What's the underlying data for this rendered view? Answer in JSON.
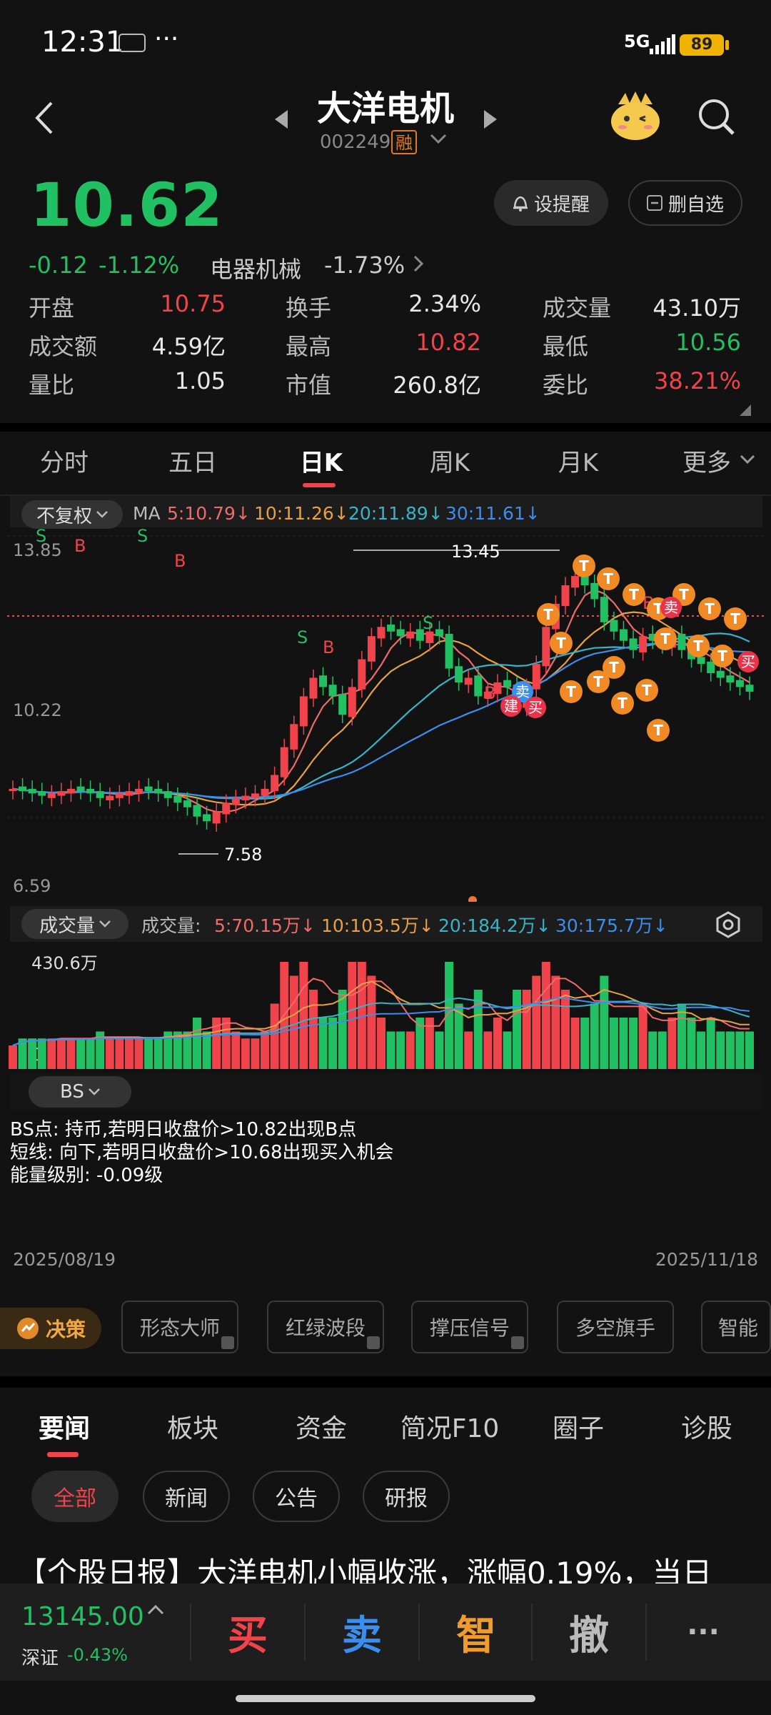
{
  "status": {
    "time": "12:31",
    "dots": "···",
    "network": "5G",
    "battery": "89"
  },
  "header": {
    "name": "大洋电机",
    "code": "002249",
    "margin_badge": "融"
  },
  "quote": {
    "price": "10.62",
    "change": "-0.12",
    "change_pct": "-1.12%",
    "sector": "电器机械",
    "sector_pct": "-1.73%",
    "alert_label": "设提醒",
    "watch_label": "删自选"
  },
  "stats": [
    {
      "label": "开盘",
      "value": "10.75",
      "color": "#f0434c"
    },
    {
      "label": "换手",
      "value": "2.34%",
      "color": "#e8e8e8"
    },
    {
      "label": "成交量",
      "value": "43.10万",
      "color": "#e8e8e8"
    },
    {
      "label": "成交额",
      "value": "4.59亿",
      "color": "#e8e8e8"
    },
    {
      "label": "最高",
      "value": "10.82",
      "color": "#f0434c"
    },
    {
      "label": "最低",
      "value": "10.56",
      "color": "#21c163"
    },
    {
      "label": "量比",
      "value": "1.05",
      "color": "#e8e8e8"
    },
    {
      "label": "市值",
      "value": "260.8亿",
      "color": "#e8e8e8"
    },
    {
      "label": "委比",
      "value": "38.21%",
      "color": "#f0434c"
    }
  ],
  "period_tabs": [
    "分时",
    "五日",
    "日K",
    "周K",
    "月K",
    "更多"
  ],
  "ma": {
    "adjust": "不复权",
    "label": "MA",
    "items": [
      {
        "text": "5:10.79↓",
        "color": "#f06a6a"
      },
      {
        "text": "10:11.26↓",
        "color": "#e8a040"
      },
      {
        "text": "20:11.89↓",
        "color": "#36b4c8"
      },
      {
        "text": "30:11.61↓",
        "color": "#3a8ef0"
      }
    ]
  },
  "kline": {
    "y_top": "13.85",
    "y_mid": "10.22",
    "y_bottom": "6.59",
    "high_label": "13.45",
    "low_label": "7.58"
  },
  "volume": {
    "button": "成交量",
    "label": "成交量:",
    "items": [
      {
        "text": "5:70.15万↓",
        "color": "#f06a6a"
      },
      {
        "text": "10:103.5万↓",
        "color": "#e8a040"
      },
      {
        "text": "20:184.2万↓",
        "color": "#36b4c8"
      },
      {
        "text": "30:175.7万↓",
        "color": "#3a8ef0"
      }
    ],
    "max_label": "430.6万",
    "zero_label": "0"
  },
  "bs": {
    "button": "BS",
    "lines": [
      "BS点: 持币,若明日收盘价>10.82出现B点",
      "短线: 向下,若明日收盘价>10.68出现买入机会",
      "能量级别: -0.09级"
    ]
  },
  "dates": {
    "start": "2025/08/19",
    "end": "2025/11/18"
  },
  "tools": {
    "decision": "决策",
    "chips": [
      "形态大师",
      "红绿波段",
      "撑压信号",
      "多空旗手",
      "智能"
    ]
  },
  "news_tabs": [
    "要闻",
    "板块",
    "资金",
    "简况F10",
    "圈子",
    "诊股"
  ],
  "filters": [
    "全部",
    "新闻",
    "公告",
    "研报"
  ],
  "headline": "【个股日报】大洋电机小幅收涨，涨幅0.19%，当日",
  "bottom": {
    "index_value": "13145.00",
    "index_name": "深证",
    "index_pct": "-0.43%",
    "buttons": [
      {
        "label": "买",
        "color": "#f0434c"
      },
      {
        "label": "卖",
        "color": "#3a8ef0"
      },
      {
        "label": "智",
        "color": "#f09a30"
      },
      {
        "label": "撤",
        "color": "#bbbbbb"
      },
      {
        "label": "···",
        "color": "#bbbbbb"
      }
    ]
  },
  "signal_labels": {
    "buy": "买",
    "sell": "卖",
    "build": "建",
    "t": "T",
    "b": "B",
    "s": "S"
  }
}
